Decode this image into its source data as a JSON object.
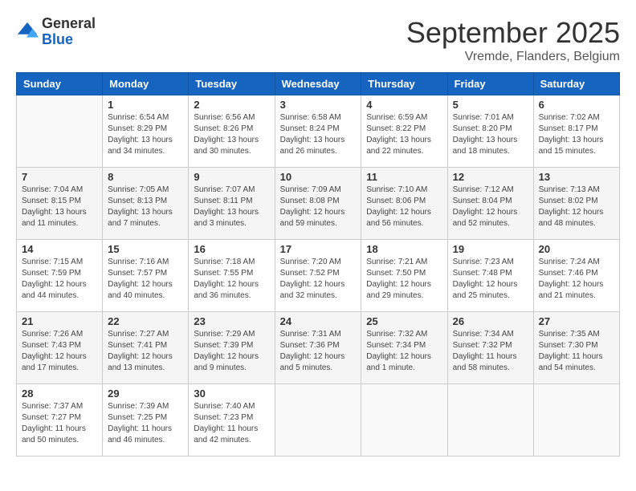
{
  "logo": {
    "general": "General",
    "blue": "Blue"
  },
  "header": {
    "month": "September 2025",
    "location": "Vremde, Flanders, Belgium"
  },
  "weekdays": [
    "Sunday",
    "Monday",
    "Tuesday",
    "Wednesday",
    "Thursday",
    "Friday",
    "Saturday"
  ],
  "weeks": [
    [
      {
        "day": "",
        "sunrise": "",
        "sunset": "",
        "daylight": ""
      },
      {
        "day": "1",
        "sunrise": "Sunrise: 6:54 AM",
        "sunset": "Sunset: 8:29 PM",
        "daylight": "Daylight: 13 hours and 34 minutes."
      },
      {
        "day": "2",
        "sunrise": "Sunrise: 6:56 AM",
        "sunset": "Sunset: 8:26 PM",
        "daylight": "Daylight: 13 hours and 30 minutes."
      },
      {
        "day": "3",
        "sunrise": "Sunrise: 6:58 AM",
        "sunset": "Sunset: 8:24 PM",
        "daylight": "Daylight: 13 hours and 26 minutes."
      },
      {
        "day": "4",
        "sunrise": "Sunrise: 6:59 AM",
        "sunset": "Sunset: 8:22 PM",
        "daylight": "Daylight: 13 hours and 22 minutes."
      },
      {
        "day": "5",
        "sunrise": "Sunrise: 7:01 AM",
        "sunset": "Sunset: 8:20 PM",
        "daylight": "Daylight: 13 hours and 18 minutes."
      },
      {
        "day": "6",
        "sunrise": "Sunrise: 7:02 AM",
        "sunset": "Sunset: 8:17 PM",
        "daylight": "Daylight: 13 hours and 15 minutes."
      }
    ],
    [
      {
        "day": "7",
        "sunrise": "Sunrise: 7:04 AM",
        "sunset": "Sunset: 8:15 PM",
        "daylight": "Daylight: 13 hours and 11 minutes."
      },
      {
        "day": "8",
        "sunrise": "Sunrise: 7:05 AM",
        "sunset": "Sunset: 8:13 PM",
        "daylight": "Daylight: 13 hours and 7 minutes."
      },
      {
        "day": "9",
        "sunrise": "Sunrise: 7:07 AM",
        "sunset": "Sunset: 8:11 PM",
        "daylight": "Daylight: 13 hours and 3 minutes."
      },
      {
        "day": "10",
        "sunrise": "Sunrise: 7:09 AM",
        "sunset": "Sunset: 8:08 PM",
        "daylight": "Daylight: 12 hours and 59 minutes."
      },
      {
        "day": "11",
        "sunrise": "Sunrise: 7:10 AM",
        "sunset": "Sunset: 8:06 PM",
        "daylight": "Daylight: 12 hours and 56 minutes."
      },
      {
        "day": "12",
        "sunrise": "Sunrise: 7:12 AM",
        "sunset": "Sunset: 8:04 PM",
        "daylight": "Daylight: 12 hours and 52 minutes."
      },
      {
        "day": "13",
        "sunrise": "Sunrise: 7:13 AM",
        "sunset": "Sunset: 8:02 PM",
        "daylight": "Daylight: 12 hours and 48 minutes."
      }
    ],
    [
      {
        "day": "14",
        "sunrise": "Sunrise: 7:15 AM",
        "sunset": "Sunset: 7:59 PM",
        "daylight": "Daylight: 12 hours and 44 minutes."
      },
      {
        "day": "15",
        "sunrise": "Sunrise: 7:16 AM",
        "sunset": "Sunset: 7:57 PM",
        "daylight": "Daylight: 12 hours and 40 minutes."
      },
      {
        "day": "16",
        "sunrise": "Sunrise: 7:18 AM",
        "sunset": "Sunset: 7:55 PM",
        "daylight": "Daylight: 12 hours and 36 minutes."
      },
      {
        "day": "17",
        "sunrise": "Sunrise: 7:20 AM",
        "sunset": "Sunset: 7:52 PM",
        "daylight": "Daylight: 12 hours and 32 minutes."
      },
      {
        "day": "18",
        "sunrise": "Sunrise: 7:21 AM",
        "sunset": "Sunset: 7:50 PM",
        "daylight": "Daylight: 12 hours and 29 minutes."
      },
      {
        "day": "19",
        "sunrise": "Sunrise: 7:23 AM",
        "sunset": "Sunset: 7:48 PM",
        "daylight": "Daylight: 12 hours and 25 minutes."
      },
      {
        "day": "20",
        "sunrise": "Sunrise: 7:24 AM",
        "sunset": "Sunset: 7:46 PM",
        "daylight": "Daylight: 12 hours and 21 minutes."
      }
    ],
    [
      {
        "day": "21",
        "sunrise": "Sunrise: 7:26 AM",
        "sunset": "Sunset: 7:43 PM",
        "daylight": "Daylight: 12 hours and 17 minutes."
      },
      {
        "day": "22",
        "sunrise": "Sunrise: 7:27 AM",
        "sunset": "Sunset: 7:41 PM",
        "daylight": "Daylight: 12 hours and 13 minutes."
      },
      {
        "day": "23",
        "sunrise": "Sunrise: 7:29 AM",
        "sunset": "Sunset: 7:39 PM",
        "daylight": "Daylight: 12 hours and 9 minutes."
      },
      {
        "day": "24",
        "sunrise": "Sunrise: 7:31 AM",
        "sunset": "Sunset: 7:36 PM",
        "daylight": "Daylight: 12 hours and 5 minutes."
      },
      {
        "day": "25",
        "sunrise": "Sunrise: 7:32 AM",
        "sunset": "Sunset: 7:34 PM",
        "daylight": "Daylight: 12 hours and 1 minute."
      },
      {
        "day": "26",
        "sunrise": "Sunrise: 7:34 AM",
        "sunset": "Sunset: 7:32 PM",
        "daylight": "Daylight: 11 hours and 58 minutes."
      },
      {
        "day": "27",
        "sunrise": "Sunrise: 7:35 AM",
        "sunset": "Sunset: 7:30 PM",
        "daylight": "Daylight: 11 hours and 54 minutes."
      }
    ],
    [
      {
        "day": "28",
        "sunrise": "Sunrise: 7:37 AM",
        "sunset": "Sunset: 7:27 PM",
        "daylight": "Daylight: 11 hours and 50 minutes."
      },
      {
        "day": "29",
        "sunrise": "Sunrise: 7:39 AM",
        "sunset": "Sunset: 7:25 PM",
        "daylight": "Daylight: 11 hours and 46 minutes."
      },
      {
        "day": "30",
        "sunrise": "Sunrise: 7:40 AM",
        "sunset": "Sunset: 7:23 PM",
        "daylight": "Daylight: 11 hours and 42 minutes."
      },
      {
        "day": "",
        "sunrise": "",
        "sunset": "",
        "daylight": ""
      },
      {
        "day": "",
        "sunrise": "",
        "sunset": "",
        "daylight": ""
      },
      {
        "day": "",
        "sunrise": "",
        "sunset": "",
        "daylight": ""
      },
      {
        "day": "",
        "sunrise": "",
        "sunset": "",
        "daylight": ""
      }
    ]
  ]
}
